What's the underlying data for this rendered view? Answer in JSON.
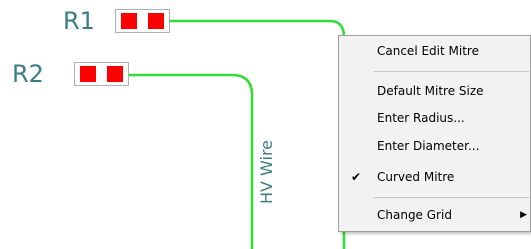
{
  "canvas": {
    "wire_color": "#33dd33",
    "pad_color": "#ff0000",
    "label_color": "#3a7d84",
    "components": [
      {
        "designator": "R1"
      },
      {
        "designator": "R2"
      }
    ],
    "wire_label": "HV Wire"
  },
  "context_menu": {
    "items": [
      {
        "label": "Cancel Edit Mitre",
        "checked": false,
        "submenu": false
      },
      {
        "label": "Default Mitre Size",
        "checked": false,
        "submenu": false
      },
      {
        "label": "Enter Radius...",
        "checked": false,
        "submenu": false
      },
      {
        "label": "Enter Diameter...",
        "checked": false,
        "submenu": false
      },
      {
        "label": "Curved Mitre",
        "checked": true,
        "submenu": false
      },
      {
        "label": "Change Grid",
        "checked": false,
        "submenu": true
      }
    ],
    "check_glyph": "✔",
    "submenu_glyph": "▶"
  }
}
